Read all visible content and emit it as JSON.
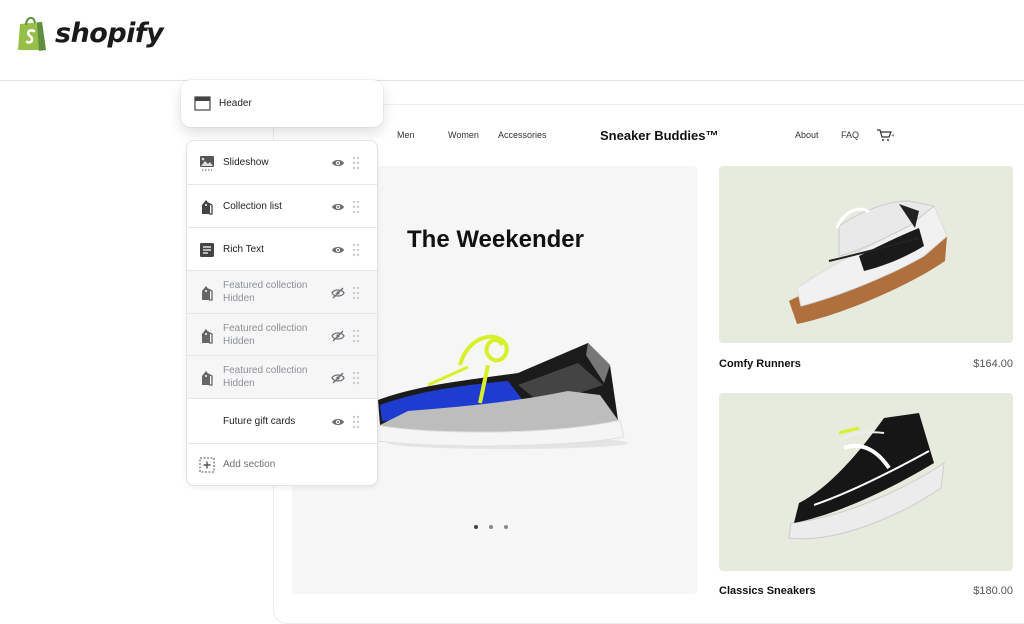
{
  "brand": {
    "logo_text": "shopify"
  },
  "editor": {
    "header_label": "Header",
    "sections": [
      {
        "label": "Slideshow",
        "sub": "",
        "icon": "image-icon",
        "hidden": false
      },
      {
        "label": "Collection list",
        "sub": "",
        "icon": "tag-icon",
        "hidden": false
      },
      {
        "label": "Rich Text",
        "sub": "",
        "icon": "text-icon",
        "hidden": false
      },
      {
        "label": "Featured collection",
        "sub": "Hidden",
        "icon": "tag-icon",
        "hidden": true
      },
      {
        "label": "Featured collection",
        "sub": "Hidden",
        "icon": "tag-icon",
        "hidden": true
      },
      {
        "label": "Featured collection",
        "sub": "Hidden",
        "icon": "tag-icon",
        "hidden": true
      },
      {
        "label": "Future gift cards",
        "sub": "",
        "icon": "",
        "hidden": false
      }
    ],
    "add_section_label": "Add section"
  },
  "store": {
    "nav_left": [
      "Men",
      "Women",
      "Accessories"
    ],
    "name": "Sneaker Buddies™",
    "nav_right": [
      "About",
      "FAQ"
    ],
    "cart_icon": "cart-icon",
    "hero_title": "The Weekender",
    "slides": 3,
    "active_slide": 1,
    "products": [
      {
        "name": "Comfy Runners",
        "price": "$164.00"
      },
      {
        "name": "Classics Sneakers",
        "price": "$180.00"
      }
    ]
  },
  "colors": {
    "brand_green": "#95bf47",
    "product_bg": "#e7ebdd",
    "hero_bg": "#f6f6f6"
  }
}
